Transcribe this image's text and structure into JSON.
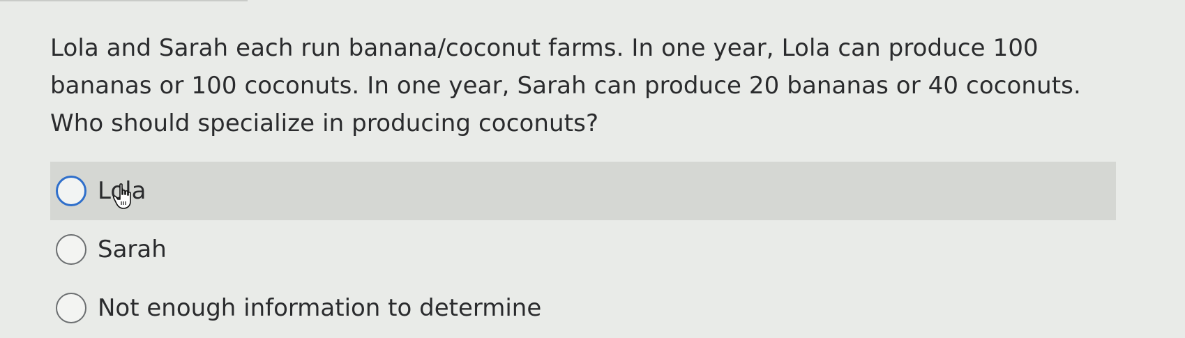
{
  "question": {
    "text": "Lola and Sarah each run banana/coconut farms. In one year, Lola can produce 100 bananas or 100 coconuts. In one year, Sarah can produce 20 bananas or 40 coconuts. Who should specialize in producing coconuts?"
  },
  "options": [
    {
      "label": "Lola"
    },
    {
      "label": "Sarah"
    },
    {
      "label": "Not enough information to determine"
    }
  ],
  "state": {
    "highlighted_option": "Lola",
    "selected_option": null
  },
  "colors": {
    "background": "#e9ebe8",
    "highlight": "#d5d7d3",
    "focus_ring": "#2f6fcb",
    "text": "#2a2b2d"
  },
  "icons": {
    "cursor": "hand-pointer-icon"
  }
}
